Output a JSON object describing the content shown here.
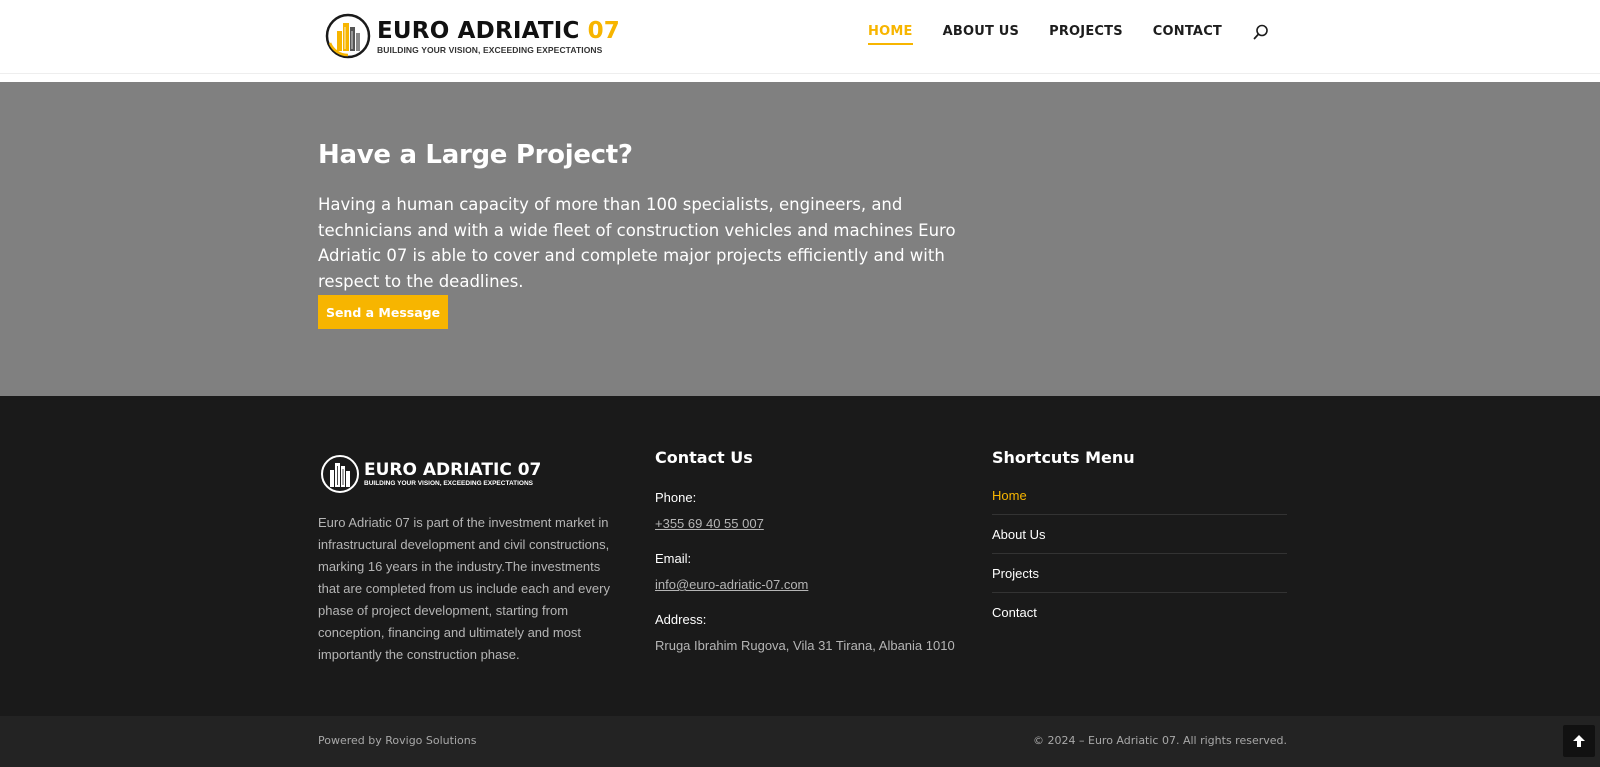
{
  "header": {
    "logo": {
      "title": "EURO ADRIATIC",
      "number": "07",
      "tagline": "BUILDING YOUR VISION, EXCEEDING EXPECTATIONS"
    },
    "nav": [
      {
        "label": "HOME",
        "active": true
      },
      {
        "label": "ABOUT US",
        "active": false
      },
      {
        "label": "PROJECTS",
        "active": false
      },
      {
        "label": "CONTACT",
        "active": false
      }
    ],
    "search_icon": "search-icon"
  },
  "hero": {
    "title": "Have a Large Project?",
    "text": "Having a human capacity of more than 100 specialists, engineers, and technicians and with a wide fleet of construction vehicles and machines Euro Adriatic 07 is able to cover and complete major projects efficiently and with respect to the deadlines.",
    "button_label": "Send a Message"
  },
  "footer": {
    "logo": {
      "title": "EURO ADRIATIC 07",
      "tagline": "BUILDING YOUR VISION, EXCEEDING EXPECTATIONS"
    },
    "about": "Euro Adriatic 07 is part of the investment market in infrastructural development and civil constructions, marking 16 years in the industry.The investments that are completed from us include each and every phase of project development, starting from conception, financing and ultimately and most importantly the construction phase.",
    "contact": {
      "title": "Contact Us",
      "phone_label": "Phone:",
      "phone": "+355 69 40 55 007",
      "email_label": "Email:",
      "email": "info@euro-adriatic-07.com",
      "address_label": "Address:",
      "address": "Rruga Ibrahim Rugova, Vila 31 Tirana, Albania 1010"
    },
    "shortcuts": {
      "title": "Shortcuts Menu",
      "items": [
        "Home",
        "About Us",
        "Projects",
        "Contact"
      ]
    }
  },
  "bottom_bar": {
    "powered": "Powered by Rovigo Solutions",
    "copyright": "© 2024 – Euro Adriatic 07. All rights reserved.",
    "to_top_icon": "arrow-up-icon"
  },
  "colors": {
    "accent": "#f7b500",
    "hero_bg": "#808080",
    "footer_bg": "#1a1a1a",
    "bottom_bar_bg": "#232323"
  }
}
